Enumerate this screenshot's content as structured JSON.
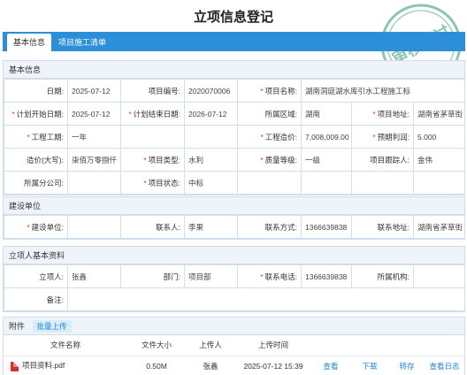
{
  "page": {
    "title": "立项信息登记"
  },
  "stamp": {
    "text": "审核通过",
    "color": "#2f9a6a"
  },
  "tabs": [
    {
      "label": "基本信息",
      "active": true
    },
    {
      "label": "项目施工清单",
      "active": false
    }
  ],
  "basic": {
    "section_title": "基本信息",
    "rows": [
      [
        {
          "label": "日期:",
          "value": "2025-07-12",
          "required": false
        },
        {
          "label": "项目编号:",
          "value": "2020070006",
          "required": false
        },
        {
          "label": "项目名称:",
          "value": "湖南洞庭湖水库引水工程施工标",
          "required": true
        }
      ],
      [
        {
          "label": "计划开始日期:",
          "value": "2025-07-12",
          "required": true
        },
        {
          "label": "计划结束日期:",
          "value": "2026-07-12",
          "required": true
        },
        {
          "label": "所属区域:",
          "value": "湖南",
          "required": false
        },
        {
          "label": "项目地址:",
          "value": "湖南省茅草街",
          "required": true
        }
      ],
      [
        {
          "label": "工程工期:",
          "value": "一年",
          "required": true
        },
        {
          "label": "",
          "value": "",
          "required": false
        },
        {
          "label": "工程造价:",
          "value": "7,008,009.00",
          "required": true
        },
        {
          "label": "预期利润:",
          "value": "5.000",
          "required": true
        }
      ],
      [
        {
          "label": "造价(大写):",
          "value": "柒佰万零捌仟",
          "required": false
        },
        {
          "label": "项目类型:",
          "value": "水利",
          "required": true
        },
        {
          "label": "质量等级:",
          "value": "一级",
          "required": true
        },
        {
          "label": "项目跟踪人:",
          "value": "金伟",
          "required": false
        }
      ],
      [
        {
          "label": "所属分公司:",
          "value": "",
          "required": false
        },
        {
          "label": "项目状态:",
          "value": "中标",
          "required": true
        },
        {
          "label": "",
          "value": "",
          "required": false
        },
        {
          "label": "",
          "value": "",
          "required": false
        }
      ]
    ]
  },
  "construction": {
    "section_title": "建设单位",
    "row": [
      {
        "label": "建设单位:",
        "value": "",
        "required": true
      },
      {
        "label": "联系人:",
        "value": "李果",
        "required": false
      },
      {
        "label": "联系方式:",
        "value": "1366639838",
        "required": false
      },
      {
        "label": "联系地址:",
        "value": "湖南省茅草街",
        "required": false
      }
    ]
  },
  "person": {
    "section_title": "立项人基本资料",
    "row": [
      {
        "label": "立项人:",
        "value": "张鑫",
        "required": false
      },
      {
        "label": "部门:",
        "value": "项目部",
        "required": false
      },
      {
        "label": "联系电话:",
        "value": "1366639838",
        "required": true
      },
      {
        "label": "所属机构:",
        "value": "",
        "required": false
      }
    ],
    "remark_label": "备注:",
    "remark_value": ""
  },
  "attachments": {
    "section_title": "附件",
    "upload_label": "批量上传",
    "columns": [
      "文件名称",
      "文件大小",
      "上传人",
      "上传时间"
    ],
    "files": [
      {
        "name": "项目资料.pdf",
        "size": "0.50M",
        "uploader": "张鑫",
        "time": "2025-07-12 15:39",
        "actions": [
          "查看",
          "下载",
          "转存",
          "查看日志"
        ]
      }
    ]
  }
}
